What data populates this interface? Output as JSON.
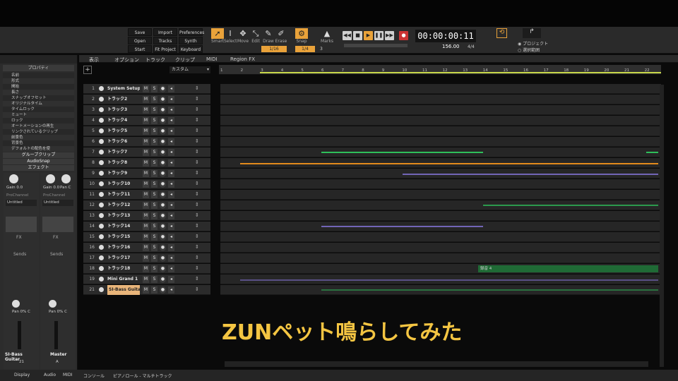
{
  "control_bar": {
    "buttons": [
      {
        "label": "Save"
      },
      {
        "label": "Import"
      },
      {
        "label": "Preferences"
      },
      {
        "label": "Open"
      },
      {
        "label": "Tracks"
      },
      {
        "label": "Synth Rack"
      },
      {
        "label": "Start Screen"
      },
      {
        "label": "Fit Project"
      },
      {
        "label": "Keyboard"
      }
    ],
    "tools": [
      {
        "label": "Smart",
        "icon": "cursor-icon",
        "active": true
      },
      {
        "label": "Select",
        "icon": "select-icon"
      },
      {
        "label": "Move",
        "icon": "move-icon"
      },
      {
        "label": "Edit",
        "icon": "edit-icon"
      },
      {
        "label": "Draw",
        "icon": "pencil-icon"
      },
      {
        "label": "Erase",
        "icon": "eraser-icon"
      }
    ],
    "snap_label": "Snap",
    "marks_label": "Marks",
    "snap_value": "1/16",
    "snap_value2": "1/4",
    "snap_num": "3",
    "time": "00:00:00:11",
    "tempo": "156.00",
    "meter": "4/4",
    "radio_project": "プロジェクト",
    "radio_selection": "選択範囲"
  },
  "views_bar": {
    "items": [
      "表示",
      "オプション",
      "トラック",
      "クリップ",
      "MIDI",
      "Region FX"
    ],
    "preset": "カスタム"
  },
  "inspector": {
    "header": "プロパティ",
    "properties": [
      "名前",
      "形式",
      "開始",
      "長さ",
      "スナップオフセット",
      "オリジナルタイム",
      "タイムロック",
      "ミュート",
      "ロック",
      "オートメーションの再生",
      "リンクされているクリップ",
      "前景色",
      "背景色",
      "デフォルトの配色を使"
    ],
    "sections": [
      "グループクリップ",
      "AudioSnap",
      "エフェクト"
    ],
    "strips": [
      {
        "gain": "Gain 0.0",
        "pan": "",
        "prochannel": "ProChannel",
        "preset": "Untitled",
        "fx": "FX",
        "sends": "Sends",
        "panlabel": "Pan 0% C",
        "name": "SI-Bass Guitar",
        "num": "21"
      },
      {
        "gain": "Gain 0.0",
        "pan": "Pan C",
        "prochannel": "ProChannel",
        "preset": "Untitled",
        "fx": "FX",
        "sends": "Sends",
        "panlabel": "Pan 0% C",
        "name": "Master",
        "num": "A"
      }
    ]
  },
  "ruler": {
    "ticks": [
      "1",
      "2",
      "3",
      "4",
      "5",
      "6",
      "7",
      "8",
      "9",
      "10",
      "11",
      "12",
      "13",
      "14",
      "15",
      "16",
      "17",
      "18",
      "19",
      "20",
      "21",
      "22"
    ]
  },
  "tracks": [
    {
      "num": "1",
      "name": "System Setup"
    },
    {
      "num": "2",
      "name": "トラック2"
    },
    {
      "num": "3",
      "name": "トラック3"
    },
    {
      "num": "4",
      "name": "トラック4"
    },
    {
      "num": "5",
      "name": "トラック5"
    },
    {
      "num": "6",
      "name": "トラック6"
    },
    {
      "num": "7",
      "name": "トラック7"
    },
    {
      "num": "8",
      "name": "トラック8"
    },
    {
      "num": "9",
      "name": "トラック9"
    },
    {
      "num": "10",
      "name": "トラック10"
    },
    {
      "num": "11",
      "name": "トラック11"
    },
    {
      "num": "12",
      "name": "トラック12"
    },
    {
      "num": "13",
      "name": "トラック13"
    },
    {
      "num": "14",
      "name": "トラック14"
    },
    {
      "num": "15",
      "name": "トラック15"
    },
    {
      "num": "16",
      "name": "トラック16"
    },
    {
      "num": "17",
      "name": "トラック17"
    },
    {
      "num": "18",
      "name": "トラック18"
    },
    {
      "num": "19",
      "name": "Mini Grand 1"
    },
    {
      "num": "21",
      "name": "SI-Bass Guitar"
    }
  ],
  "clip_label": "録音 4",
  "caption": "ZUNペット鳴らしてみた",
  "bottom_tabs": [
    "Display",
    "Audio",
    "MIDI"
  ],
  "console_tabs": [
    "コンソール",
    "ピアノロール - マルチトラック"
  ],
  "colors": {
    "accent": "#e9a23a",
    "caption": "#f4c542",
    "green": "#2fbf5a",
    "purple": "#8c7ae6",
    "orange": "#e28a1c"
  }
}
